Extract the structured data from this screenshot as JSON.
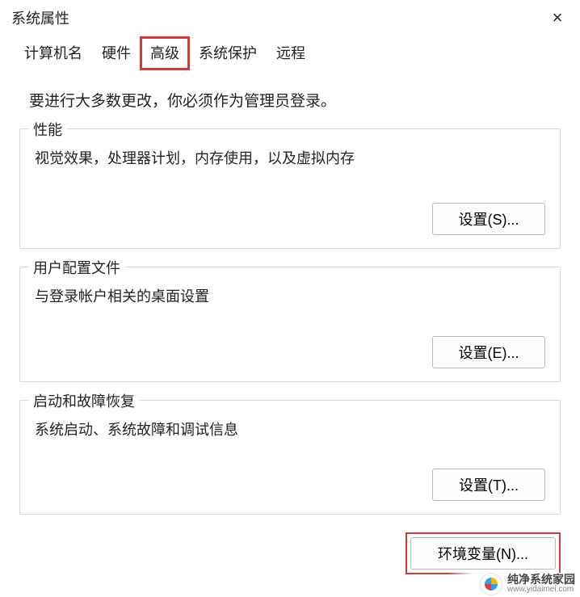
{
  "window": {
    "title": "系统属性",
    "close_glyph": "×"
  },
  "tabs": {
    "items": [
      {
        "label": "计算机名"
      },
      {
        "label": "硬件"
      },
      {
        "label": "高级"
      },
      {
        "label": "系统保护"
      },
      {
        "label": "远程"
      }
    ],
    "active_index": 2
  },
  "intro": "要进行大多数更改，你必须作为管理员登录。",
  "groups": {
    "performance": {
      "legend": "性能",
      "desc": "视觉效果，处理器计划，内存使用，以及虚拟内存",
      "button": "设置(S)..."
    },
    "profiles": {
      "legend": "用户配置文件",
      "desc": "与登录帐户相关的桌面设置",
      "button": "设置(E)..."
    },
    "startup": {
      "legend": "启动和故障恢复",
      "desc": "系统启动、系统故障和调试信息",
      "button": "设置(T)..."
    }
  },
  "env_button": "环境变量(N)...",
  "watermark": {
    "name": "纯净系统家园",
    "url": "www.yidaimei.com"
  }
}
